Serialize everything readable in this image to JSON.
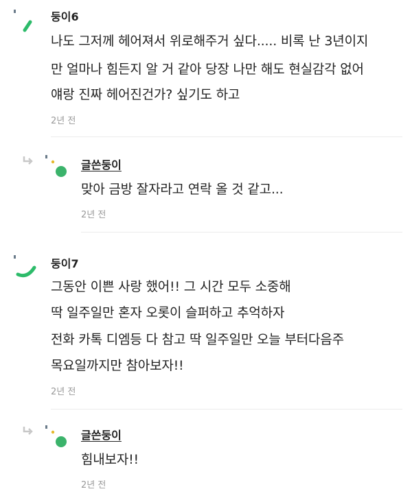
{
  "comments": [
    {
      "author": "둥이6",
      "lines": [
        "나도 그저께 헤어져서 위로해주거 싶다..... 비록 난 3년이지",
        "만 얼마나 힘든지 알 거 같아 당장 나만 해도 현실감각 없어",
        "얘랑 진짜 헤어진건가? 싶기도 하고"
      ],
      "time": "2년 전"
    },
    {
      "author": "글쓴둥이",
      "lines": [
        "맞아 금방 잘자라고 연락 올 것 같고..."
      ],
      "time": "2년 전"
    },
    {
      "author": "둥이7",
      "lines": [
        "그동안 이쁜 사랑 했어!! 그 시간 모두 소중해",
        "딱 일주일만 혼자 오롯이 슬퍼하고 추억하자",
        "전화 카톡 디엠등 다 참고 딱 일주일만 오늘 부터다음주",
        "목요일까지만 참아보자!!"
      ],
      "time": "2년 전"
    },
    {
      "author": "글쓴둥이",
      "lines": [
        "힘내보자!!"
      ],
      "time": "2년 전"
    }
  ],
  "icons": {
    "reply": "reply-arrow-icon",
    "avatar_accent": "#2dbb6a",
    "avatar_dot": "#3bb36b",
    "avatar_small_dot": "#e5b82d"
  }
}
